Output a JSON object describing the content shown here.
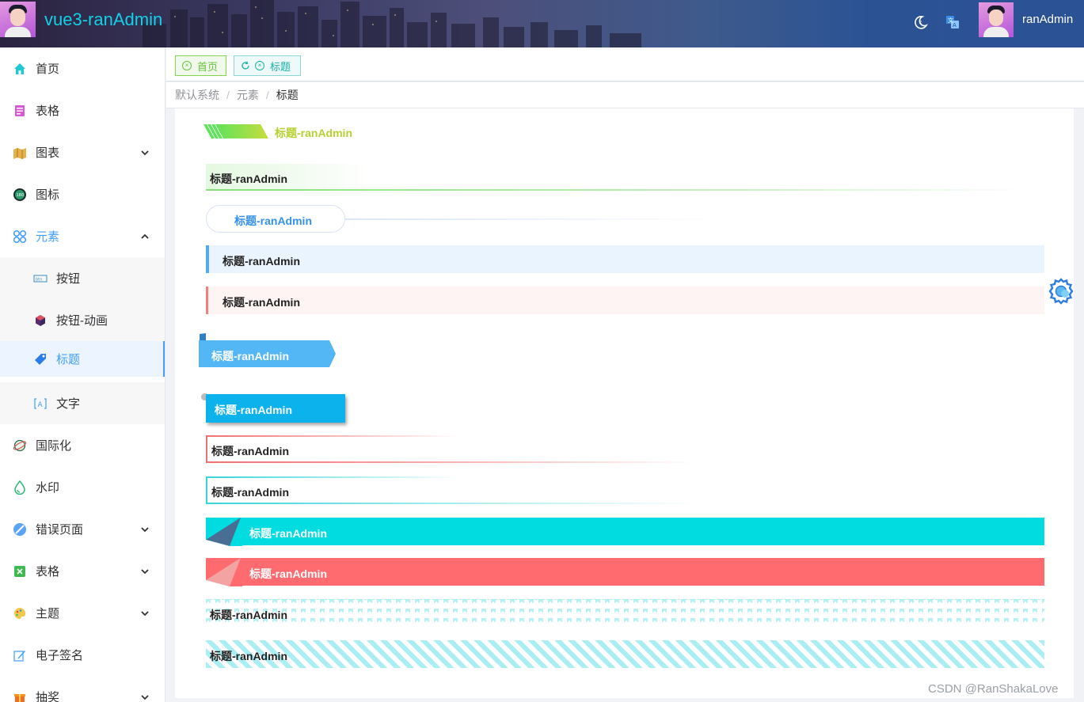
{
  "header": {
    "app_title": "vue3-ranAdmin",
    "username": "ranAdmin",
    "icons": [
      "moon-icon",
      "translate-icon"
    ]
  },
  "sidebar": {
    "items": [
      {
        "label": "首页",
        "icon": "home-icon",
        "color": "#20c8d8"
      },
      {
        "label": "表格",
        "icon": "table-icon",
        "color": "#d957d9"
      },
      {
        "label": "图表",
        "icon": "chart-icon",
        "color": "#e6a23c",
        "expandable": true
      },
      {
        "label": "图标",
        "icon": "icon-icon",
        "color": "#2a9a6a"
      },
      {
        "label": "元素",
        "icon": "elements-icon",
        "color": "#409eff",
        "expandable": true,
        "expanded": true
      },
      {
        "label": "按钮",
        "icon": "button-icon",
        "sub": true
      },
      {
        "label": "按钮-动画",
        "icon": "cube-icon",
        "sub": true
      },
      {
        "label": "标题",
        "icon": "tag-icon",
        "sub": true,
        "active": true
      },
      {
        "label": "文字",
        "icon": "text-icon",
        "sub": true
      },
      {
        "label": "国际化",
        "icon": "globe-icon"
      },
      {
        "label": "水印",
        "icon": "drop-icon"
      },
      {
        "label": "错误页面",
        "icon": "error-icon",
        "expandable": true
      },
      {
        "label": "表格",
        "icon": "excel-icon",
        "expandable": true
      },
      {
        "label": "主题",
        "icon": "palette-icon",
        "expandable": true
      },
      {
        "label": "电子签名",
        "icon": "sign-icon"
      },
      {
        "label": "抽奖",
        "icon": "gift-icon",
        "expandable": true
      }
    ]
  },
  "tabs": [
    {
      "label": "首页"
    },
    {
      "label": "标题"
    }
  ],
  "breadcrumb": [
    "默认系统",
    "元素",
    "标题"
  ],
  "titles": [
    "标题-ranAdmin",
    "标题-ranAdmin",
    "标题-ranAdmin",
    "标题-ranAdmin",
    "标题-ranAdmin",
    "标题-ranAdmin",
    "标题-ranAdmin",
    "标题-ranAdmin",
    "标题-ranAdmin",
    "标题-ranAdmin",
    "标题-ranAdmin",
    "标题-ranAdmin",
    "标题-ranAdmin"
  ],
  "watermark": "CSDN @RanShakaLove",
  "colors": {
    "accent": "#409eff",
    "cyan": "#00dce0",
    "red": "#ff6b6f",
    "green": "#6ed46a"
  }
}
